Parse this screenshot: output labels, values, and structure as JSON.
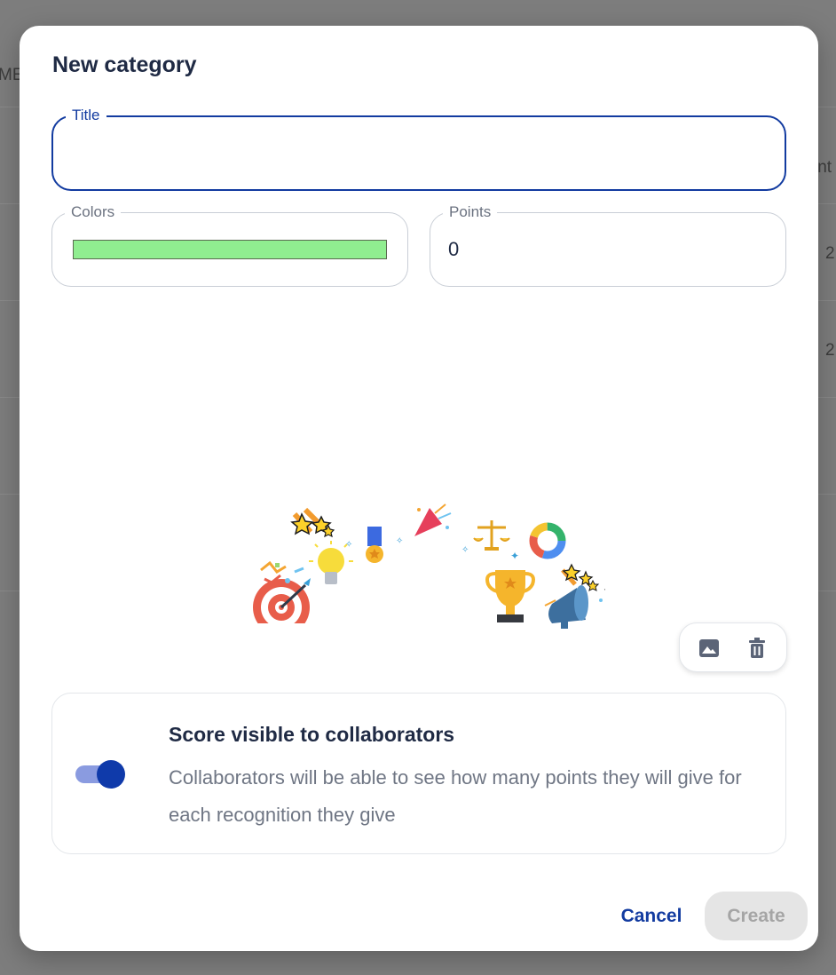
{
  "background": {
    "left_partial_text": "ME",
    "right_partial_text": "int",
    "row_values": [
      "2",
      "2"
    ]
  },
  "modal": {
    "title": "New category",
    "title_field": {
      "label": "Title",
      "value": "",
      "placeholder": ""
    },
    "colors_field": {
      "label": "Colors",
      "selected_color": "#90ee90"
    },
    "points_field": {
      "label": "Points",
      "value": "0"
    },
    "illustration": {
      "icons": [
        "target-icon",
        "lightbulb-icon",
        "confetti-icon",
        "shooting-stars-icon",
        "medal-icon",
        "party-popper-icon",
        "scales-icon",
        "donut-chart-icon",
        "trophy-icon",
        "megaphone-icon"
      ]
    },
    "image_actions": {
      "upload_icon": "image-icon",
      "delete_icon": "trash-icon"
    },
    "visibility": {
      "enabled": true,
      "heading": "Score visible to collaborators",
      "description": "Collaborators will be able to see how many points they will give for each recognition they give"
    },
    "actions": {
      "cancel_label": "Cancel",
      "create_label": "Create"
    }
  },
  "colors": {
    "accent": "#123ba0",
    "toggle_track": "#8a9be0",
    "disabled_bg": "#e5e5e5",
    "overlay": "#7f7f7f"
  }
}
